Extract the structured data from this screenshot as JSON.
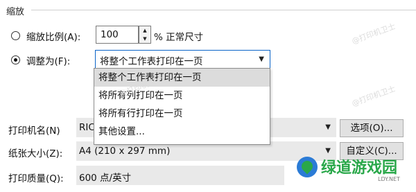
{
  "section_title": "缩放",
  "scale": {
    "label": "缩放比例(A):",
    "value": "100",
    "unit": "% 正常尺寸"
  },
  "fit": {
    "label": "调整为(F):",
    "selected": "将整个工作表打印在一页",
    "options": [
      "将整个工作表打印在一页",
      "将所有列打印在一页",
      "将所有行打印在一页",
      "其他设置..."
    ]
  },
  "printer": {
    "label": "打印机名(N)",
    "value": "RIC",
    "options_button": "选项(O)..."
  },
  "paper": {
    "label": "纸张大小(Z):",
    "value": "A4 (210 x 297 mm)",
    "custom_button": "自定义(C)..."
  },
  "quality": {
    "label": "打印质量(Q):",
    "value": "600 点/英寸"
  },
  "watermark_text": "@打印机卫士",
  "logo": {
    "name": "绿道游戏园",
    "sub": "LDY.NET"
  },
  "colors": {
    "accent_border": "#0a64c8",
    "logo_green": "#2aa84a",
    "logo_blue": "#2b7bd6"
  },
  "icons": {
    "spin_up": "▲",
    "spin_down": "▼",
    "dropdown_caret": "▼"
  }
}
